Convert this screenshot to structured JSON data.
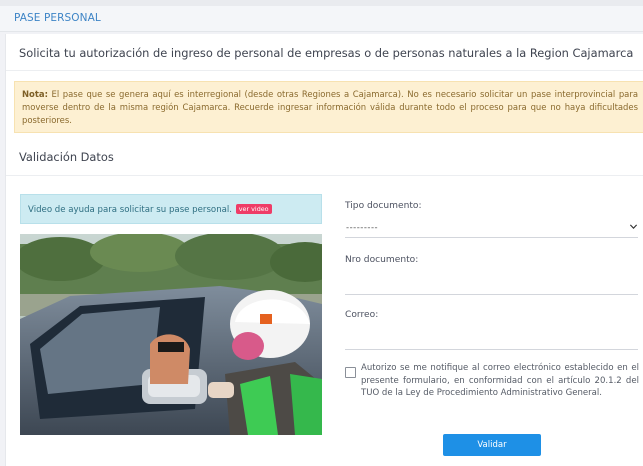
{
  "header": {
    "title": "PASE PERSONAL"
  },
  "card": {
    "title": "Solicita tu autorización de ingreso de personal de empresas o de personas naturales a la Region Cajamarca",
    "note_label": "Nota:",
    "note_text": "El pase que se genera aquí es interregional (desde otras Regiones a Cajamarca). No es necesario solicitar un pase interprovincial para moverse dentro de la misma región Cajamarca. Recuerde ingresar información válida durante todo el proceso para que no haya dificultades posteriores.",
    "section_title": "Validación Datos"
  },
  "video_help": {
    "strong": "Video",
    "text": " de ayuda para solicitar su pase personal.",
    "badge": "ver video"
  },
  "form": {
    "tipo_documento_label": "Tipo documento:",
    "tipo_documento_value": "---------",
    "nro_documento_label": "Nro documento:",
    "nro_documento_value": "",
    "correo_label": "Correo:",
    "correo_value": "",
    "consent_text": "Autorizo se me notifique al correo electrónico establecido en el presente formulario, en conformidad con el artículo 20.1.2 del TUO de la Ley de Procedimiento Administrativo General.",
    "consent_checked": false,
    "submit_label": "Validar"
  },
  "colors": {
    "header_text": "#3d84c6",
    "note_bg": "#fdf0d2",
    "video_box_bg": "#cdebf2",
    "badge_bg": "#ef3c67",
    "button_bg": "#1e90e6"
  }
}
